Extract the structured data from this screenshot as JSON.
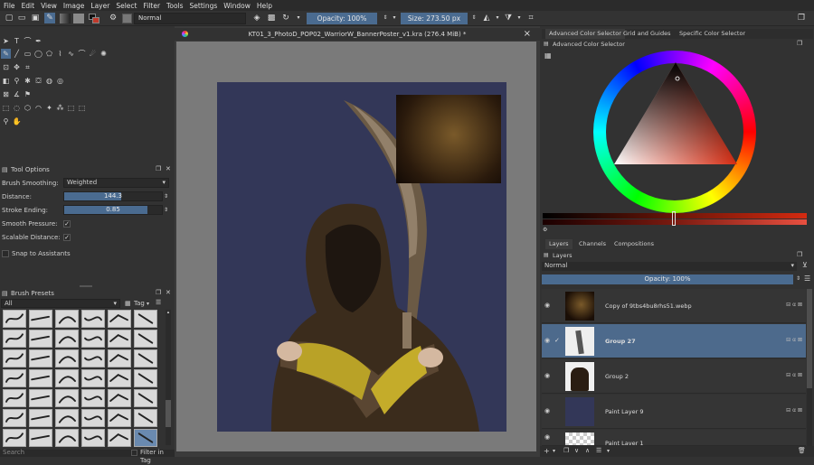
{
  "menu": [
    "File",
    "Edit",
    "View",
    "Image",
    "Layer",
    "Select",
    "Filter",
    "Tools",
    "Settings",
    "Window",
    "Help"
  ],
  "toolbar": {
    "blend_mode": "Normal",
    "opacity": "Opacity: 100%",
    "size": "Size: 273.50 px"
  },
  "document": {
    "tab_title": "KT01_3_PhotoD_POP02_WarriorW_BannerPoster_v1.kra (276.4 MiB) *",
    "close": "×"
  },
  "tool_options": {
    "title": "Tool Options",
    "brush_smoothing_label": "Brush Smoothing:",
    "brush_smoothing_value": "Weighted",
    "distance_label": "Distance:",
    "distance_value": "144.3",
    "distance_fraction": 0.58,
    "stroke_ending_label": "Stroke Ending:",
    "stroke_ending_value": "0.85",
    "stroke_ending_fraction": 0.85,
    "smooth_pressure_label": "Smooth Pressure:",
    "smooth_pressure_checked": "✓",
    "scalable_distance_label": "Scalable Distance:",
    "scalable_distance_checked": "✓",
    "snap_label": "Snap to Assistants"
  },
  "brush_presets": {
    "title": "Brush Presets",
    "filter_value": "All",
    "tag_label": "Tag",
    "search_placeholder": "Search",
    "filter_in_tag": "Filter in Tag"
  },
  "color_panel": {
    "tabs": [
      "Advanced Color Selector",
      "Grid and Guides",
      "Specific Color Selector"
    ],
    "subtitle": "Advanced Color Selector"
  },
  "layers_panel": {
    "tabs": [
      "Layers",
      "Channels",
      "Compositions"
    ],
    "title": "Layers",
    "blend_mode": "Normal",
    "opacity": "Opacity:  100%",
    "layers": [
      {
        "name": "Copy of 9tbs4bu8rhs51.webp"
      },
      {
        "name": "Group 27"
      },
      {
        "name": "Group 2"
      },
      {
        "name": "Paint Layer 9"
      },
      {
        "name": "Paint Layer 1"
      }
    ]
  },
  "colors": {
    "accent": "#4a6b90",
    "canvas_bg": "#333758"
  }
}
